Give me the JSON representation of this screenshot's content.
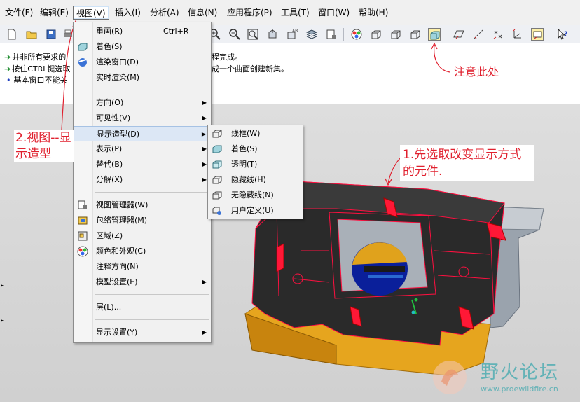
{
  "menubar": {
    "items": [
      {
        "label": "文件(F)"
      },
      {
        "label": "编辑(E)"
      },
      {
        "label": "视图(V)"
      },
      {
        "label": "插入(I)"
      },
      {
        "label": "分析(A)"
      },
      {
        "label": "信息(N)"
      },
      {
        "label": "应用程序(P)"
      },
      {
        "label": "工具(T)"
      },
      {
        "label": "窗口(W)"
      },
      {
        "label": "帮助(H)"
      }
    ],
    "active_index": 2
  },
  "messages": [
    {
      "arrow": "➔",
      "text": "并非所有要求的",
      "suffix": "程完成。"
    },
    {
      "arrow": "➔",
      "text": "按住CTRL键选取",
      "suffix": "成一个曲面创建新集。"
    },
    {
      "bullet": "•",
      "text": "基本窗口不能关"
    }
  ],
  "view_menu": {
    "items": [
      {
        "label": "重画(R)",
        "shortcut": "Ctrl+R",
        "icon": "repaint-icon"
      },
      {
        "label": "着色(S)",
        "icon": "shade-icon"
      },
      {
        "label": "渲染窗口(D)",
        "icon": "render-window-icon"
      },
      {
        "label": "实时渲染(M)"
      },
      {
        "label": "方向(O)",
        "submenu": true
      },
      {
        "label": "可见性(V)",
        "submenu": true
      },
      {
        "label": "显示造型(D)",
        "submenu": true,
        "highlighted": true
      },
      {
        "label": "表示(P)",
        "submenu": true
      },
      {
        "label": "替代(B)",
        "submenu": true
      },
      {
        "label": "分解(X)",
        "submenu": true
      },
      {
        "label": "视图管理器(W)",
        "icon": "view-manager-icon"
      },
      {
        "label": "包络管理器(M)",
        "icon": "envelope-manager-icon"
      },
      {
        "label": "区域(Z)",
        "icon": "zone-icon"
      },
      {
        "label": "颜色和外观(C)",
        "icon": "color-appearance-icon"
      },
      {
        "label": "注释方向(N)"
      },
      {
        "label": "模型设置(E)",
        "submenu": true
      },
      {
        "label": "层(L)..."
      },
      {
        "label": "显示设置(Y)",
        "submenu": true
      }
    ],
    "submenu_arrow": "▶"
  },
  "display_style_submenu": {
    "items": [
      {
        "label": "线框(W)",
        "icon": "wireframe-icon"
      },
      {
        "label": "着色(S)",
        "icon": "shading-icon"
      },
      {
        "label": "透明(T)",
        "icon": "transparent-icon"
      },
      {
        "label": "隐藏线(H)",
        "icon": "hidden-line-icon"
      },
      {
        "label": "无隐藏线(N)",
        "icon": "no-hidden-icon"
      },
      {
        "label": "用户定义(U)",
        "icon": "user-defined-icon"
      }
    ]
  },
  "annotations": {
    "note": "注意此处",
    "step2": "2.视图--显示造型",
    "step1": "1.先选取改变显示方式的元件."
  },
  "watermark": {
    "title": "野火论坛",
    "url": "www.proewildfire.cn"
  },
  "colors": {
    "annotation_red": "#e0202e",
    "menu_highlight": "#dce7f5",
    "model_black": "#2a2a2a",
    "model_orange": "#e6a51e",
    "model_grey": "#9aa3ad",
    "edge_highlight": "#ff1040"
  }
}
